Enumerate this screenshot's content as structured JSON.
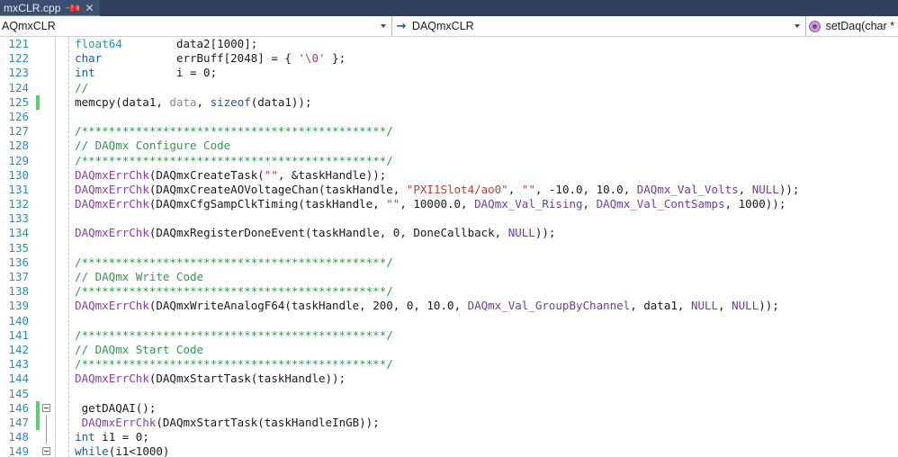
{
  "tab": {
    "title": "mxCLR.cpp",
    "pin_icon": "pin-icon",
    "close_icon": "close-icon"
  },
  "navbar": {
    "scope_label": "AQmxCLR",
    "class_label": "DAQmxCLR",
    "class_icon": "arrow-right-icon",
    "member_label": "setDaq(char *",
    "member_icon": "method-icon"
  },
  "editor": {
    "first_line": 121,
    "lines": [
      {
        "num": "121",
        "change": "none",
        "fold": "none",
        "tokens": [
          {
            "t": "  ",
            "c": "plain"
          },
          {
            "t": "float64",
            "c": "type"
          },
          {
            "t": "        data2[1000];",
            "c": "plain"
          }
        ]
      },
      {
        "num": "122",
        "change": "none",
        "fold": "none",
        "tokens": [
          {
            "t": "  ",
            "c": "plain"
          },
          {
            "t": "char",
            "c": "kw"
          },
          {
            "t": "           errBuff[2048] = { ",
            "c": "plain"
          },
          {
            "t": "'\\0'",
            "c": "str"
          },
          {
            "t": " };",
            "c": "plain"
          }
        ]
      },
      {
        "num": "123",
        "change": "none",
        "fold": "none",
        "tokens": [
          {
            "t": "  ",
            "c": "plain"
          },
          {
            "t": "int",
            "c": "kw"
          },
          {
            "t": "            i = 0;",
            "c": "plain"
          }
        ]
      },
      {
        "num": "124",
        "change": "none",
        "fold": "none",
        "tokens": [
          {
            "t": "  ",
            "c": "plain"
          },
          {
            "t": "//",
            "c": "cmt"
          }
        ]
      },
      {
        "num": "125",
        "change": "added",
        "fold": "none",
        "tokens": [
          {
            "t": "  memcpy(data1, ",
            "c": "plain"
          },
          {
            "t": "data",
            "c": "dim"
          },
          {
            "t": ", ",
            "c": "plain"
          },
          {
            "t": "sizeof",
            "c": "kw"
          },
          {
            "t": "(data1));",
            "c": "plain"
          }
        ]
      },
      {
        "num": "126",
        "change": "none",
        "fold": "none",
        "tokens": []
      },
      {
        "num": "127",
        "change": "none",
        "fold": "none",
        "tokens": [
          {
            "t": "  /*********************************************/",
            "c": "cmt"
          }
        ]
      },
      {
        "num": "128",
        "change": "none",
        "fold": "none",
        "tokens": [
          {
            "t": "  // DAQmx Configure Code",
            "c": "cmt"
          }
        ]
      },
      {
        "num": "129",
        "change": "none",
        "fold": "none",
        "tokens": [
          {
            "t": "  /*********************************************/",
            "c": "cmt"
          }
        ]
      },
      {
        "num": "130",
        "change": "none",
        "fold": "none",
        "tokens": [
          {
            "t": "  ",
            "c": "plain"
          },
          {
            "t": "DAQmxErrChk",
            "c": "macro"
          },
          {
            "t": "(DAQmxCreateTask(",
            "c": "plain"
          },
          {
            "t": "\"\"",
            "c": "str"
          },
          {
            "t": ", &taskHandle));",
            "c": "plain"
          }
        ]
      },
      {
        "num": "131",
        "change": "none",
        "fold": "none",
        "tokens": [
          {
            "t": "  ",
            "c": "plain"
          },
          {
            "t": "DAQmxErrChk",
            "c": "macro"
          },
          {
            "t": "(DAQmxCreateAOVoltageChan(taskHandle, ",
            "c": "plain"
          },
          {
            "t": "\"PXI1Slot4/ao0\"",
            "c": "str"
          },
          {
            "t": ", ",
            "c": "plain"
          },
          {
            "t": "\"\"",
            "c": "str"
          },
          {
            "t": ", -10.0, 10.0, ",
            "c": "plain"
          },
          {
            "t": "DAQmx_Val_Volts",
            "c": "const"
          },
          {
            "t": ", ",
            "c": "plain"
          },
          {
            "t": "NULL",
            "c": "const"
          },
          {
            "t": "));",
            "c": "plain"
          }
        ]
      },
      {
        "num": "132",
        "change": "none",
        "fold": "none",
        "tokens": [
          {
            "t": "  ",
            "c": "plain"
          },
          {
            "t": "DAQmxErrChk",
            "c": "macro"
          },
          {
            "t": "(DAQmxCfgSampClkTiming(taskHandle, ",
            "c": "plain"
          },
          {
            "t": "\"\"",
            "c": "str"
          },
          {
            "t": ", 10000.0, ",
            "c": "plain"
          },
          {
            "t": "DAQmx_Val_Rising",
            "c": "const"
          },
          {
            "t": ", ",
            "c": "plain"
          },
          {
            "t": "DAQmx_Val_ContSamps",
            "c": "const"
          },
          {
            "t": ", 1000));",
            "c": "plain"
          }
        ]
      },
      {
        "num": "133",
        "change": "none",
        "fold": "none",
        "tokens": []
      },
      {
        "num": "134",
        "change": "none",
        "fold": "none",
        "tokens": [
          {
            "t": "  ",
            "c": "plain"
          },
          {
            "t": "DAQmxErrChk",
            "c": "macro"
          },
          {
            "t": "(DAQmxRegisterDoneEvent(taskHandle, 0, DoneCallback, ",
            "c": "plain"
          },
          {
            "t": "NULL",
            "c": "const"
          },
          {
            "t": "));",
            "c": "plain"
          }
        ]
      },
      {
        "num": "135",
        "change": "none",
        "fold": "none",
        "tokens": []
      },
      {
        "num": "136",
        "change": "none",
        "fold": "none",
        "tokens": [
          {
            "t": "  /*********************************************/",
            "c": "cmt"
          }
        ]
      },
      {
        "num": "137",
        "change": "none",
        "fold": "none",
        "tokens": [
          {
            "t": "  // DAQmx Write Code",
            "c": "cmt"
          }
        ]
      },
      {
        "num": "138",
        "change": "none",
        "fold": "none",
        "tokens": [
          {
            "t": "  /*********************************************/",
            "c": "cmt"
          }
        ]
      },
      {
        "num": "139",
        "change": "none",
        "fold": "none",
        "tokens": [
          {
            "t": "  ",
            "c": "plain"
          },
          {
            "t": "DAQmxErrChk",
            "c": "macro"
          },
          {
            "t": "(DAQmxWriteAnalogF64(taskHandle, 200, 0, 10.0, ",
            "c": "plain"
          },
          {
            "t": "DAQmx_Val_GroupByChannel",
            "c": "const"
          },
          {
            "t": ", data1, ",
            "c": "plain"
          },
          {
            "t": "NULL",
            "c": "const"
          },
          {
            "t": ", ",
            "c": "plain"
          },
          {
            "t": "NULL",
            "c": "const"
          },
          {
            "t": "));",
            "c": "plain"
          }
        ]
      },
      {
        "num": "140",
        "change": "none",
        "fold": "none",
        "tokens": []
      },
      {
        "num": "141",
        "change": "none",
        "fold": "none",
        "tokens": [
          {
            "t": "  /*********************************************/",
            "c": "cmt"
          }
        ]
      },
      {
        "num": "142",
        "change": "none",
        "fold": "none",
        "tokens": [
          {
            "t": "  // DAQmx Start Code",
            "c": "cmt"
          }
        ]
      },
      {
        "num": "143",
        "change": "none",
        "fold": "none",
        "tokens": [
          {
            "t": "  /*********************************************/",
            "c": "cmt"
          }
        ]
      },
      {
        "num": "144",
        "change": "none",
        "fold": "none",
        "tokens": [
          {
            "t": "  ",
            "c": "plain"
          },
          {
            "t": "DAQmxErrChk",
            "c": "macro"
          },
          {
            "t": "(DAQmxStartTask(taskHandle));",
            "c": "plain"
          }
        ]
      },
      {
        "num": "145",
        "change": "none",
        "fold": "none",
        "tokens": []
      },
      {
        "num": "146",
        "change": "added",
        "fold": "open",
        "tokens": [
          {
            "t": "   getDAQAI();",
            "c": "plain"
          }
        ]
      },
      {
        "num": "147",
        "change": "added",
        "fold": "line",
        "tokens": [
          {
            "t": "   ",
            "c": "plain"
          },
          {
            "t": "DAQmxErrChk",
            "c": "macro"
          },
          {
            "t": "(DAQmxStartTask(taskHandleInGB));",
            "c": "plain"
          }
        ]
      },
      {
        "num": "148",
        "change": "none",
        "fold": "line",
        "tokens": [
          {
            "t": "  ",
            "c": "plain"
          },
          {
            "t": "int",
            "c": "kw"
          },
          {
            "t": " i1 = 0;",
            "c": "plain"
          }
        ]
      },
      {
        "num": "149",
        "change": "none",
        "fold": "open",
        "tokens": [
          {
            "t": "  ",
            "c": "plain"
          },
          {
            "t": "while",
            "c": "kw"
          },
          {
            "t": "(i1<1000)",
            "c": "plain"
          }
        ]
      }
    ]
  },
  "colors": {
    "tab_active_bg": "#3d4f6e",
    "tabstrip_bg": "#2f3f5c",
    "keyword": "#1b57b5",
    "type": "#2b91af",
    "comment": "#2e9c4a",
    "string": "#b5433a",
    "macro": "#8b3fa8",
    "constant": "#6b3fa0",
    "linenumber": "#2b91af",
    "changebar_added": "#57d26e"
  }
}
